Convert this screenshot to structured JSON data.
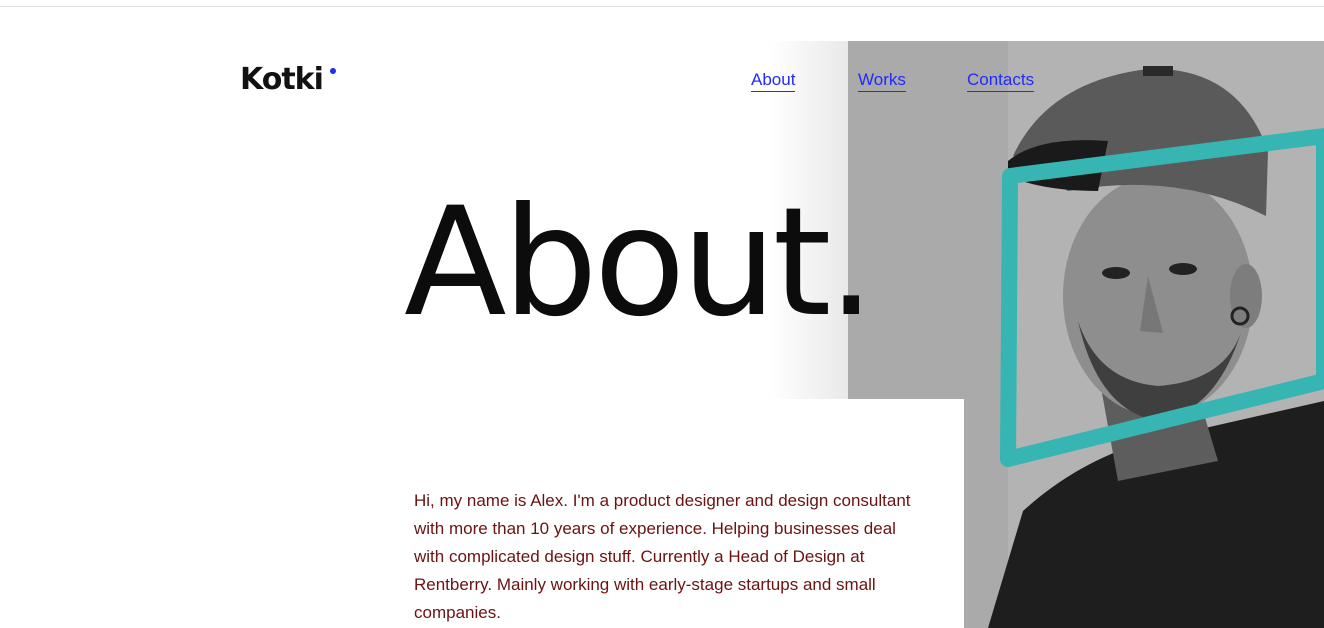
{
  "brand": {
    "logo_text": "Kotki",
    "accent_color": "#1f2bff"
  },
  "nav": {
    "items": [
      {
        "label": "About"
      },
      {
        "label": "Works"
      },
      {
        "label": "Contacts"
      }
    ]
  },
  "hero": {
    "heading": "About.",
    "photo_icon": "portrait-photo-icon",
    "frame_color": "#36b5b3"
  },
  "bio": {
    "text": "Hi, my name is Alex. I'm a product designer and design consultant with more than 10 years of experience. Helping businesses deal with complicated design stuff. Currently a Head of Design at Rentberry. Mainly working with early-stage startups and small companies.",
    "text_color": "#6b1212"
  }
}
